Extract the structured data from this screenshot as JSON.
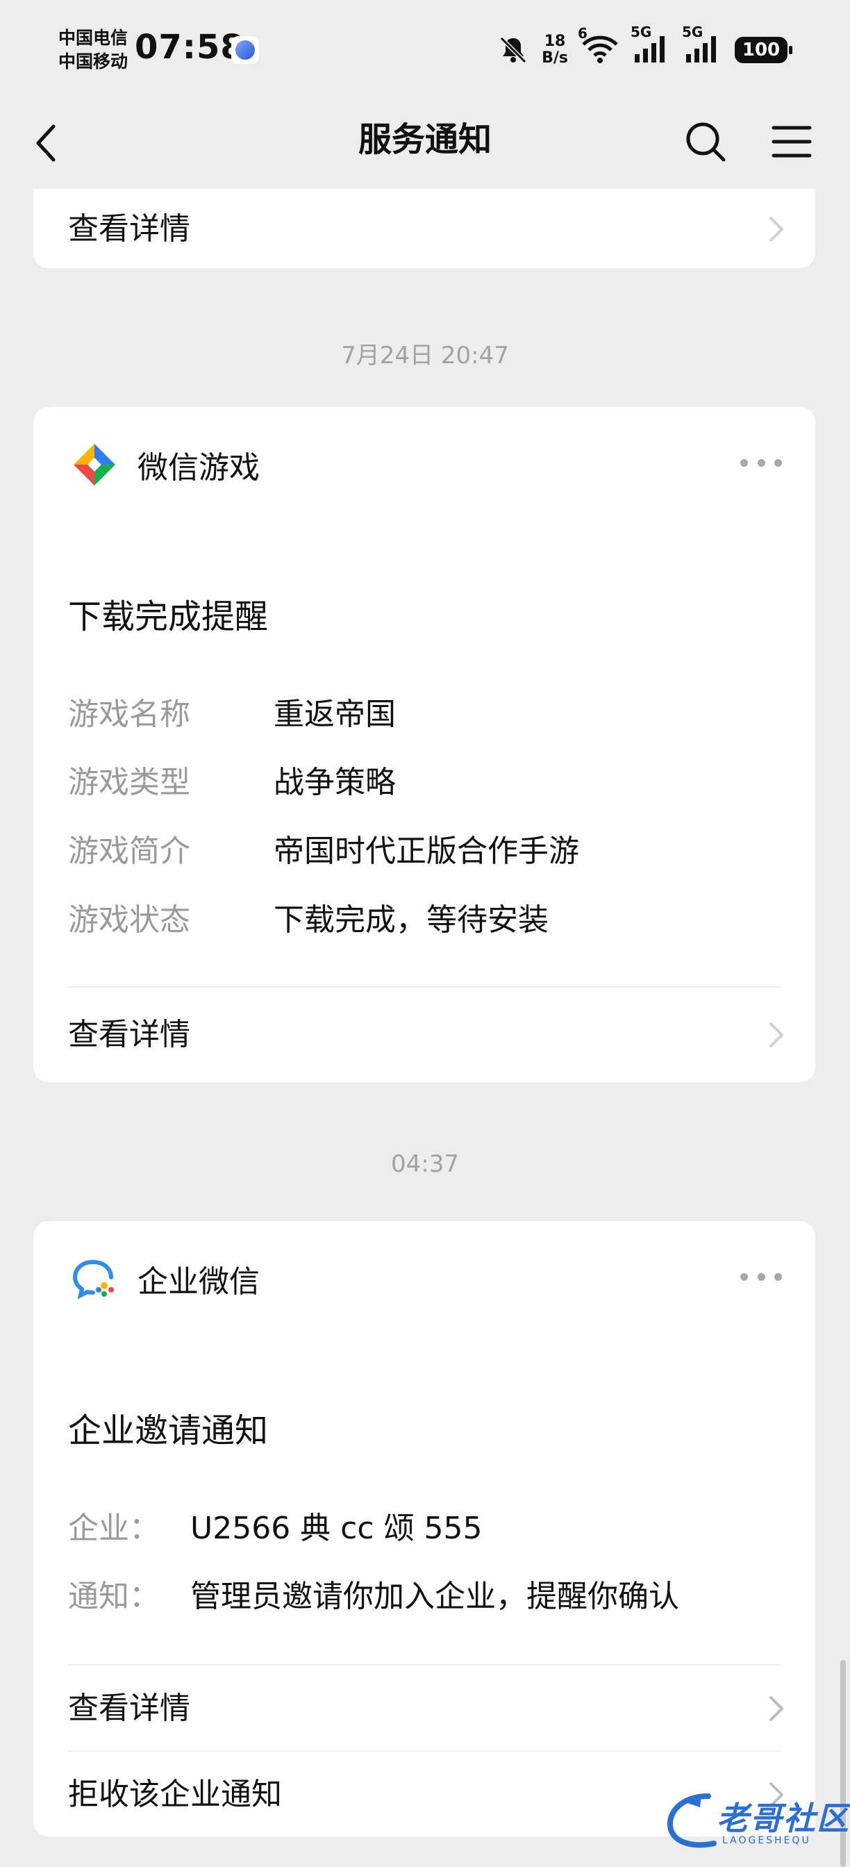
{
  "status_bar": {
    "carrier_1": "中国电信",
    "carrier_2": "中国移动",
    "time": "07:58",
    "speed_value": "18",
    "speed_unit": "B/s",
    "wifi_label": "6",
    "net_label_1": "5G",
    "net_label_2": "5G",
    "battery": "100"
  },
  "nav": {
    "title": "服务通知",
    "icons": [
      "back-icon",
      "search-icon",
      "menu-icon"
    ]
  },
  "prev_card": {
    "link_label": "查看详情"
  },
  "timestamps": [
    "7月24日 20:47",
    "04:37"
  ],
  "game_card": {
    "brand": "微信游戏",
    "title": "下载完成提醒",
    "rows": [
      {
        "key": "游戏名称",
        "value": "重返帝国"
      },
      {
        "key": "游戏类型",
        "value": "战争策略"
      },
      {
        "key": "游戏简介",
        "value": "帝国时代正版合作手游"
      },
      {
        "key": "游戏状态",
        "value": "下载完成，等待安装"
      }
    ],
    "link_label": "查看详情"
  },
  "work_card": {
    "brand": "企业微信",
    "title": "企业邀请通知",
    "rows": [
      {
        "key": "企业：",
        "value": "U2566 典 cc 颂 555"
      },
      {
        "key": "通知：",
        "value": "管理员邀请你加入企业，提醒你确认"
      }
    ],
    "link_label": "查看详情",
    "reject_label": "拒收该企业通知"
  },
  "watermark": {
    "text": "老哥社区",
    "sub": "LAOGESHEQU"
  },
  "colors": {
    "background": "#ededed",
    "card": "#ffffff",
    "muted_text": "#9a9a9a",
    "timestamp_text": "#a3a3a3"
  }
}
